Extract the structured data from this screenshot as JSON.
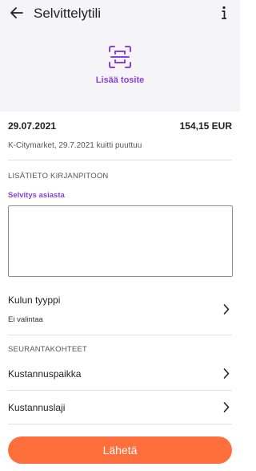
{
  "header": {
    "title": "Selvittelytili",
    "back_icon": "arrow-left-icon",
    "info_icon": "info-icon"
  },
  "attachment": {
    "label": "Lisää tosite",
    "icon": "scan-document-icon"
  },
  "receipt": {
    "date": "29.07.2021",
    "amount": "154,15 EUR",
    "description": "K-Citymarket, 29.7.2021 kuitti puuttuu"
  },
  "accounting_info": {
    "section_title": "LISÄTIETO KIRJANPITOON",
    "field_label": "Selvitys asiasta",
    "field_value": "",
    "field_placeholder": ""
  },
  "expense_type": {
    "label": "Kulun tyyppi",
    "value": "Ei valintaa"
  },
  "tracking": {
    "section_title": "SEURANTAKOHTEET",
    "items": [
      {
        "label": "Kustannuspaikka"
      },
      {
        "label": "Kustannuslaji"
      }
    ]
  },
  "actions": {
    "send_label": "Lähetä"
  },
  "colors": {
    "accent": "#8a3fe0",
    "primary_button": "#ff6f3c",
    "header_bg": "#f5f5f7"
  }
}
